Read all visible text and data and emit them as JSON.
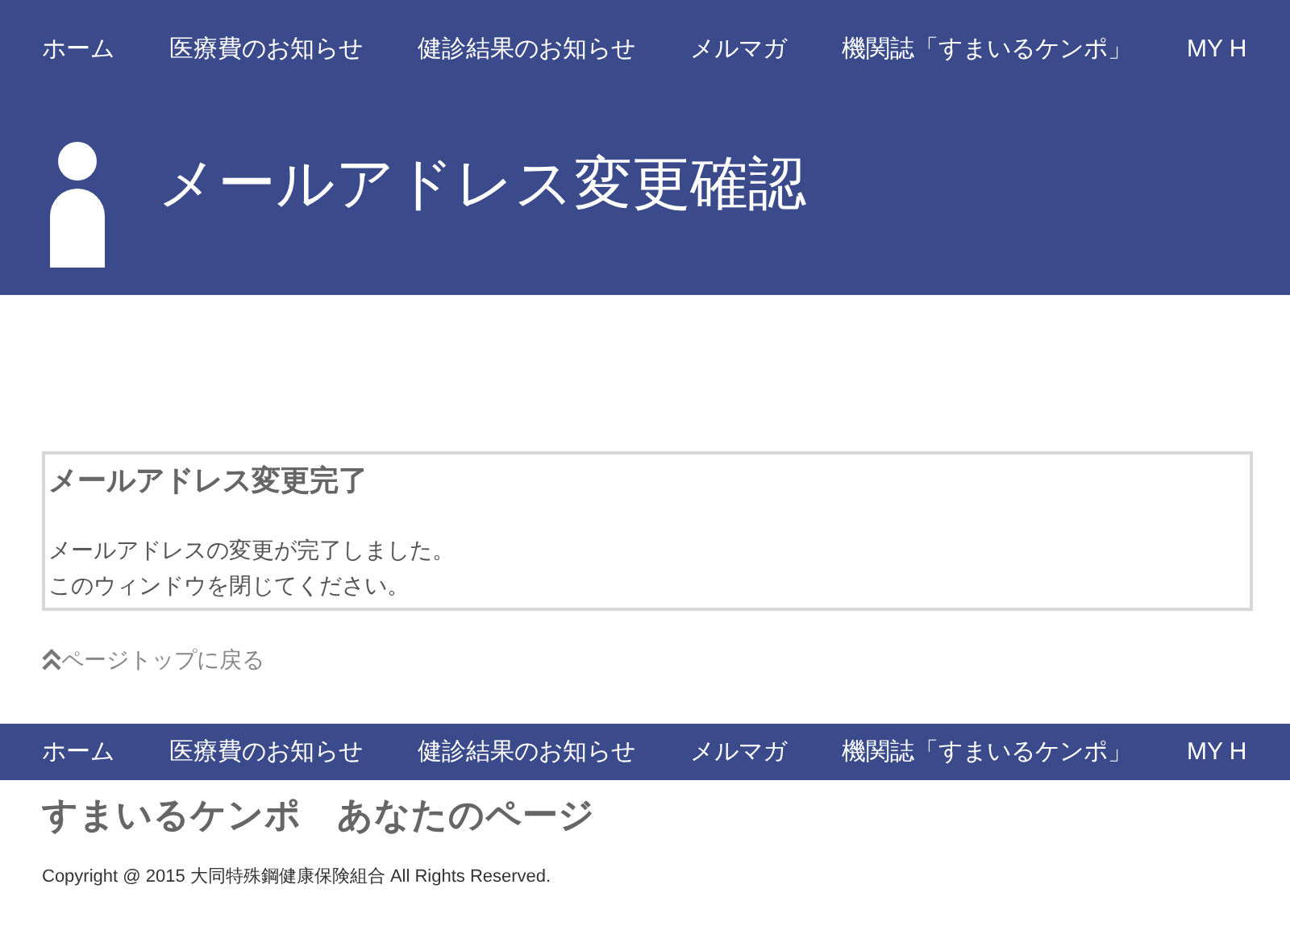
{
  "top_nav": [
    {
      "label": "ホーム"
    },
    {
      "label": "医療費のお知らせ"
    },
    {
      "label": "健診結果のお知らせ"
    },
    {
      "label": "メルマガ"
    },
    {
      "label": "機関誌「すまいるケンポ」"
    },
    {
      "label": "MY H"
    }
  ],
  "page_title": "メールアドレス変更確認",
  "notice": {
    "heading": "メールアドレス変更完了",
    "lines": [
      "メールアドレスの変更が完了しました。",
      "このウィンドウを閉じてください。"
    ]
  },
  "page_top_link": "ページトップに戻る",
  "footer_nav": [
    {
      "label": "ホーム"
    },
    {
      "label": "医療費のお知らせ"
    },
    {
      "label": "健診結果のお知らせ"
    },
    {
      "label": "メルマガ"
    },
    {
      "label": "機関誌「すまいるケンポ」"
    },
    {
      "label": "MY H"
    }
  ],
  "footer_title": "すまいるケンポ　あなたのページ",
  "copyright": "Copyright @ 2015 大同特殊鋼健康保険組合 All Rights Reserved."
}
